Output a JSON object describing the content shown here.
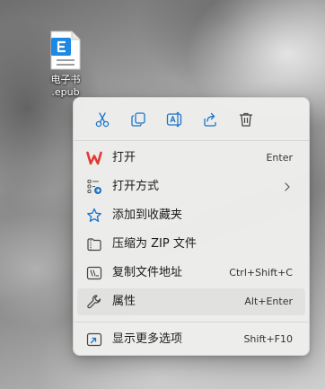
{
  "desktop": {
    "file": {
      "name": "电子书\n.epub",
      "icon": "epub-document-icon"
    }
  },
  "context_menu": {
    "quick_actions": [
      {
        "name": "cut",
        "icon": "scissors-icon"
      },
      {
        "name": "copy",
        "icon": "copy-icon"
      },
      {
        "name": "rename",
        "icon": "rename-icon"
      },
      {
        "name": "share",
        "icon": "share-icon"
      },
      {
        "name": "delete",
        "icon": "trash-icon"
      }
    ],
    "items": [
      {
        "label": "打开",
        "shortcut": "Enter",
        "icon": "wps-logo-icon"
      },
      {
        "label": "打开方式",
        "shortcut": "",
        "icon": "open-with-icon",
        "submenu": true
      },
      {
        "label": "添加到收藏夹",
        "shortcut": "",
        "icon": "star-icon"
      },
      {
        "label": "压缩为 ZIP 文件",
        "shortcut": "",
        "icon": "zip-folder-icon"
      },
      {
        "label": "复制文件地址",
        "shortcut": "Ctrl+Shift+C",
        "icon": "copy-path-icon"
      },
      {
        "label": "属性",
        "shortcut": "Alt+Enter",
        "icon": "wrench-icon",
        "highlighted": true
      },
      {
        "label": "显示更多选项",
        "shortcut": "Shift+F10",
        "icon": "more-options-icon"
      }
    ]
  },
  "colors": {
    "accent": "#1a73c9",
    "wps_red": "#e53935",
    "menu_bg": "#eeeeec",
    "hover_bg": "#e1e1df"
  }
}
